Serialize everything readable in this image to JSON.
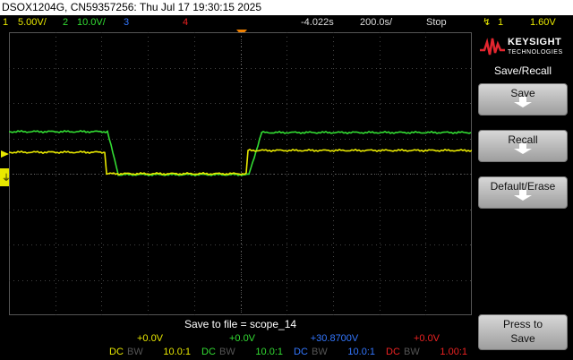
{
  "title_bar": "DSOX1204G, CN59357256: Thu Jul 17 19:30:15 2025",
  "status": {
    "ch1_num": "1",
    "ch1_scale": "5.00V/",
    "ch2_num": "2",
    "ch2_scale": "10.0V/",
    "ch3_num": "3",
    "ch4_num": "4",
    "time_offset": "-4.022s",
    "time_scale": "200.0s/",
    "run_state": "Stop",
    "trig_channel": "1",
    "trig_level": "1.60V"
  },
  "colors": {
    "ch1": "#e8e800",
    "ch2": "#33dd33",
    "ch3": "#3377ff",
    "ch4": "#ee2222"
  },
  "brand": {
    "name": "KEYSIGHT",
    "sub": "TECHNOLOGIES"
  },
  "menu": {
    "title": "Save/Recall",
    "save": "Save",
    "recall": "Recall",
    "default_erase": "Default/Erase",
    "press_to": "Press to",
    "press_action": "Save"
  },
  "save_file": "Save to file = scope_14",
  "channels": [
    {
      "offset": "+0.0V",
      "coupling": "DC",
      "bw": "BW",
      "probe": "10.0:1"
    },
    {
      "offset": "+0.0V",
      "coupling": "DC",
      "bw": "BW",
      "probe": "10.0:1"
    },
    {
      "offset": "+30.8700V",
      "coupling": "DC",
      "bw": "BW",
      "probe": "10.0:1"
    },
    {
      "offset": "+0.0V",
      "coupling": "DC",
      "bw": "BW",
      "probe": "1.00:1"
    }
  ]
}
